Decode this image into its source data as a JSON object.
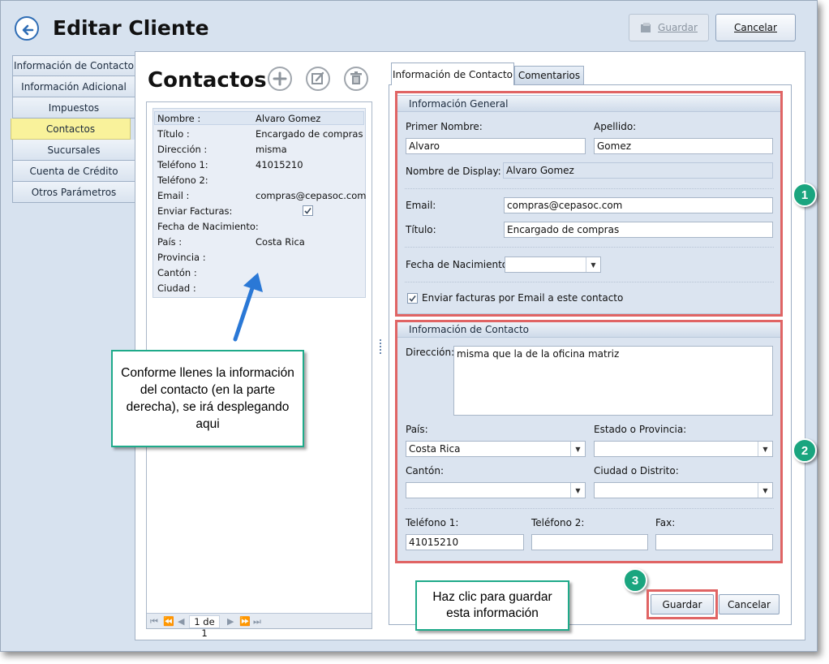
{
  "header": {
    "title": "Editar Cliente",
    "save_label": "Guardar",
    "cancel_label": "Cancelar"
  },
  "nav": {
    "items": [
      "Información de Contacto",
      "Información Adicional",
      "Impuestos",
      "Contactos",
      "Sucursales",
      "Cuenta de Crédito",
      "Otros Parámetros"
    ],
    "selected": "Contactos"
  },
  "contacts": {
    "title": "Contactos",
    "card": [
      {
        "label": "Nombre :",
        "value": "Alvaro Gomez"
      },
      {
        "label": "Título :",
        "value": "Encargado de compras"
      },
      {
        "label": "Dirección :",
        "value": "misma"
      },
      {
        "label": "Teléfono 1:",
        "value": "41015210"
      },
      {
        "label": "Teléfono 2:",
        "value": ""
      },
      {
        "label": "Email :",
        "value": "compras@cepasoc.com"
      },
      {
        "label": "Enviar Facturas:",
        "value": ""
      },
      {
        "label": "Fecha de Nacimiento:",
        "value": ""
      },
      {
        "label": "País :",
        "value": "Costa Rica"
      },
      {
        "label": "Provincia :",
        "value": ""
      },
      {
        "label": "Cantón :",
        "value": ""
      },
      {
        "label": "Ciudad :",
        "value": ""
      }
    ],
    "pager": "1 de 1"
  },
  "callouts": {
    "left": "Conforme llenes la información del contacto (en la parte derecha), se irá desplegando aqui",
    "bottom": "Haz clic para guardar esta información"
  },
  "badges": [
    "1",
    "2",
    "3"
  ],
  "tabs": [
    "Información de Contacto",
    "Comentarios"
  ],
  "general": {
    "title": "Información General",
    "first_name_label": "Primer Nombre:",
    "first_name": "Alvaro",
    "last_name_label": "Apellido:",
    "last_name": "Gomez",
    "display_label": "Nombre de Display:",
    "display": "Alvaro Gomez",
    "email_label": "Email:",
    "email": "compras@cepasoc.com",
    "title_label": "Título:",
    "title_value": "Encargado de compras",
    "birth_label": "Fecha de Nacimiento:",
    "send_label": "Enviar facturas por Email a este contacto"
  },
  "contact_info": {
    "title": "Información de Contacto",
    "address_label": "Dirección:",
    "address": "misma que la de la oficina matriz",
    "country_label": "País:",
    "country": "Costa Rica",
    "state_label": "Estado o Provincia:",
    "canton_label": "Cantón:",
    "city_label": "Ciudad o Distrito:",
    "phone1_label": "Teléfono 1:",
    "phone1": "41015210",
    "phone2_label": "Teléfono 2:",
    "fax_label": "Fax:"
  },
  "footer": {
    "save": "Guardar",
    "cancel": "Cancelar"
  },
  "colors": {
    "accent_green": "#1aa57f",
    "highlight_red": "#e06464",
    "selected_yellow": "#f9f29b",
    "arrow_blue": "#2a78d6"
  }
}
